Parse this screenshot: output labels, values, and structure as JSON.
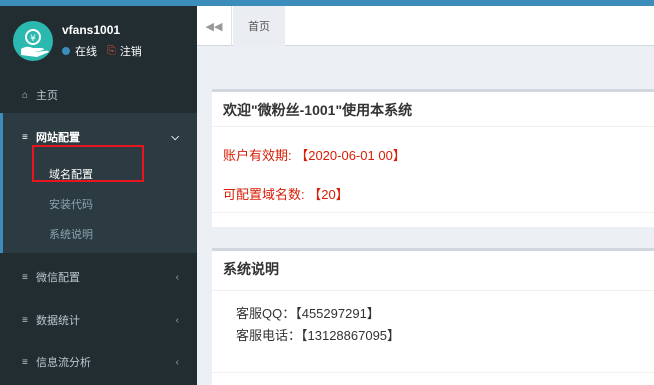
{
  "user": {
    "name": "vfans1001",
    "status": "在线",
    "logout_label": "注销"
  },
  "sidebar": {
    "items": [
      {
        "label": "主页",
        "icon": "home-icon"
      },
      {
        "label": "网站配置",
        "icon": "bars-icon",
        "expanded": true,
        "children": [
          "域名配置",
          "安装代码",
          "系统说明"
        ]
      },
      {
        "label": "微信配置",
        "icon": "bars-icon"
      },
      {
        "label": "数据统计",
        "icon": "bars-icon"
      },
      {
        "label": "信息流分析",
        "icon": "bars-icon"
      }
    ]
  },
  "tabs": [
    {
      "label": "首页"
    }
  ],
  "welcome_box": {
    "title": "欢迎\"微粉丝-1001\"使用本系统",
    "expiry": "账户有效期: 【2020-06-01 00】",
    "domain_count": "可配置域名数: 【20】"
  },
  "info_box": {
    "title": "系统说明",
    "qq": "客服QQ：【455297291】",
    "phone": "客服电话：【13128867095】"
  },
  "colors": {
    "accent": "#3c8dbc",
    "sidebar_bg": "#222d32",
    "alert_red": "#d81e06",
    "highlight_box": "#e8141f"
  }
}
